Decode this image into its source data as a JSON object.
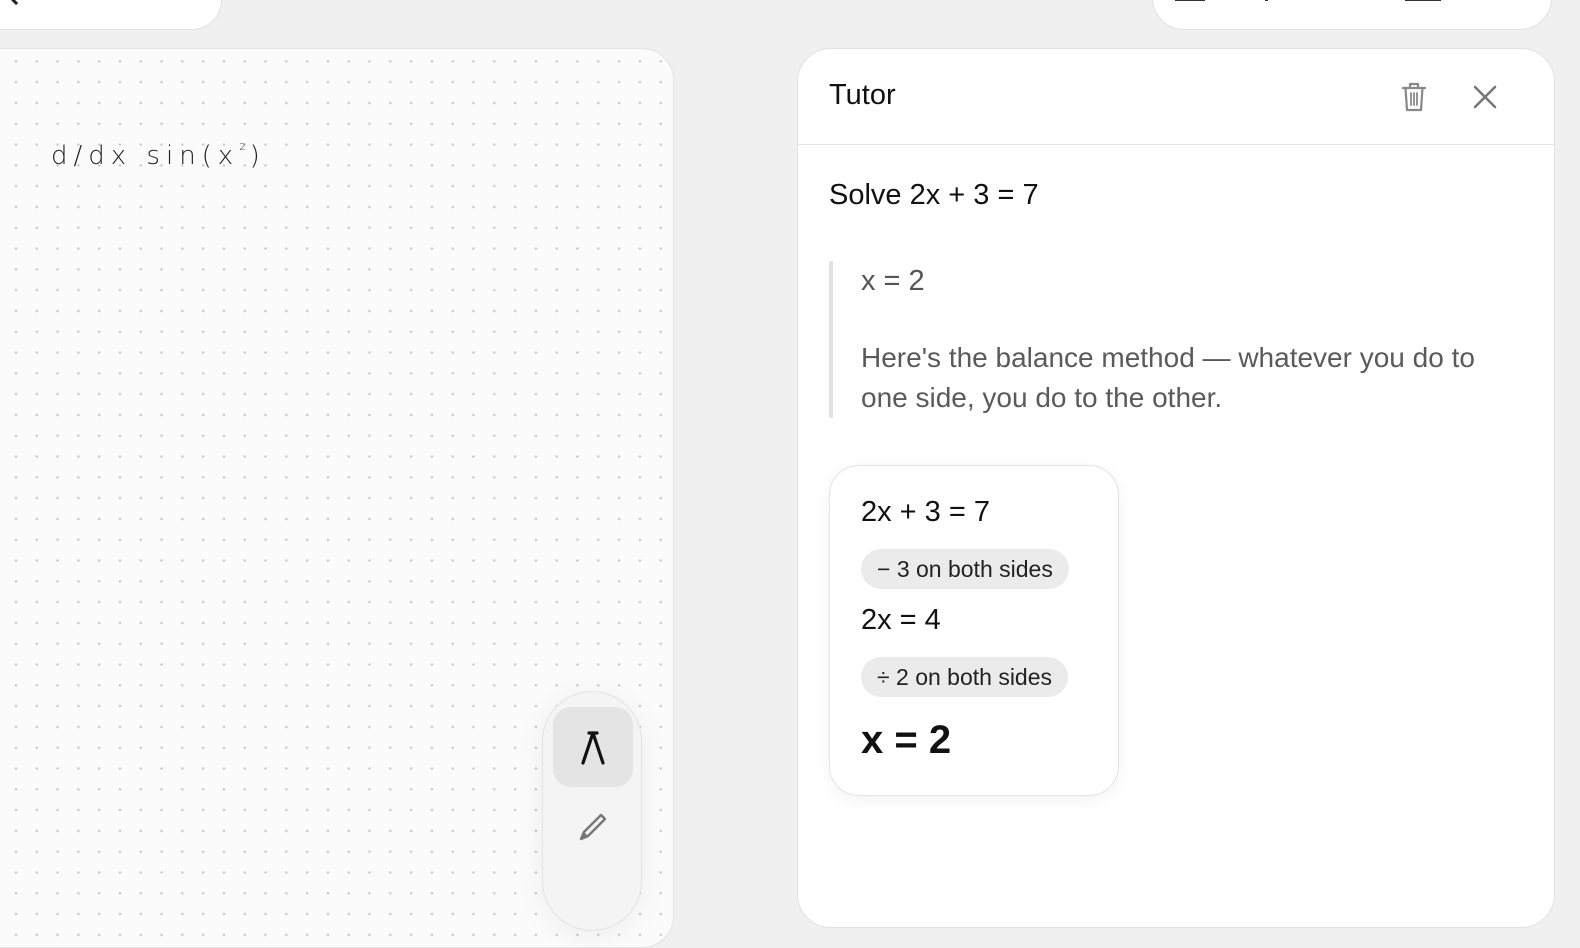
{
  "canvas": {
    "handwriting": {
      "main": "d/dx sin(x",
      "superscript": "2",
      "close": ")"
    }
  },
  "toolbar": {
    "tools": [
      {
        "name": "pen-select",
        "icon": "lambda-pen-icon",
        "active": true
      },
      {
        "name": "pencil",
        "icon": "pencil-icon",
        "active": false
      }
    ]
  },
  "tutor": {
    "title": "Tutor",
    "actions": [
      {
        "name": "delete",
        "icon": "trash-icon"
      },
      {
        "name": "close",
        "icon": "close-icon"
      }
    ],
    "question": "Solve 2x + 3 = 7",
    "answer": {
      "result": "x = 2",
      "explanation": "Here's the balance method — whatever you do to one side, you do to the other."
    },
    "steps": {
      "start_equation": "2x + 3 = 7",
      "step1_chip": "− 3 on both sides",
      "middle_equation": "2x = 4",
      "step2_chip": "÷ 2 on both sides",
      "final_equation": "x = 2"
    }
  },
  "colors": {
    "background": "#f0f0f0",
    "panel": "#ffffff",
    "chip": "#ebebeb",
    "quote_border": "#e2e2e2"
  }
}
